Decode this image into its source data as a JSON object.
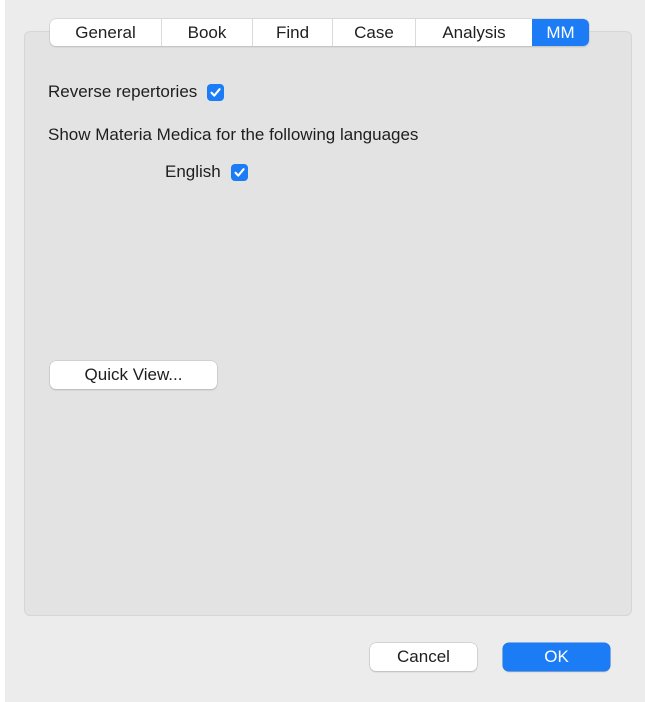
{
  "tabs": [
    {
      "label": "General",
      "active": false
    },
    {
      "label": "Book",
      "active": false
    },
    {
      "label": "Find",
      "active": false
    },
    {
      "label": "Case",
      "active": false
    },
    {
      "label": "Analysis",
      "active": false
    },
    {
      "label": "MM",
      "active": true
    }
  ],
  "mm": {
    "reverse_repertories_label": "Reverse repertories",
    "reverse_repertories_checked": true,
    "languages_heading": "Show Materia Medica for the following languages",
    "english_label": "English",
    "english_checked": true,
    "quick_view_label": "Quick View..."
  },
  "footer": {
    "cancel_label": "Cancel",
    "ok_label": "OK"
  },
  "colors": {
    "accent": "#1b7cf6",
    "window_bg": "#ececec",
    "panel_bg": "#e3e3e3"
  }
}
